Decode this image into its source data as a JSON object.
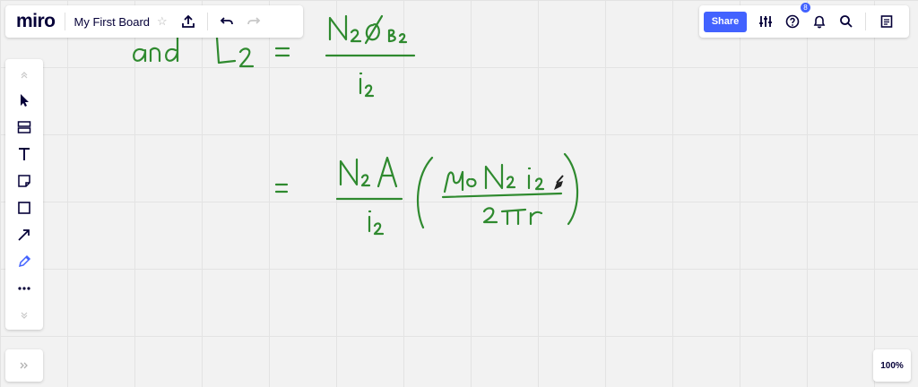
{
  "app": {
    "logo": "miro",
    "board_title": "My First Board"
  },
  "topbar": {
    "share_label": "Share",
    "notification_count": "8"
  },
  "icons": {
    "star": "star-icon",
    "upload": "upload-icon",
    "undo": "undo-icon",
    "redo": "redo-icon",
    "settings": "sliders-icon",
    "help": "help-icon",
    "bell": "bell-icon",
    "search": "search-icon",
    "notes": "notes-icon"
  },
  "toolbar": {
    "tools": [
      "select",
      "frame",
      "text",
      "sticky-note",
      "shape",
      "connection-line",
      "pen",
      "more"
    ]
  },
  "zoom": {
    "level": "100%"
  },
  "colors": {
    "accent": "#4262ff",
    "ink": "#2f8a2f",
    "canvas": "#f2f2f2"
  }
}
